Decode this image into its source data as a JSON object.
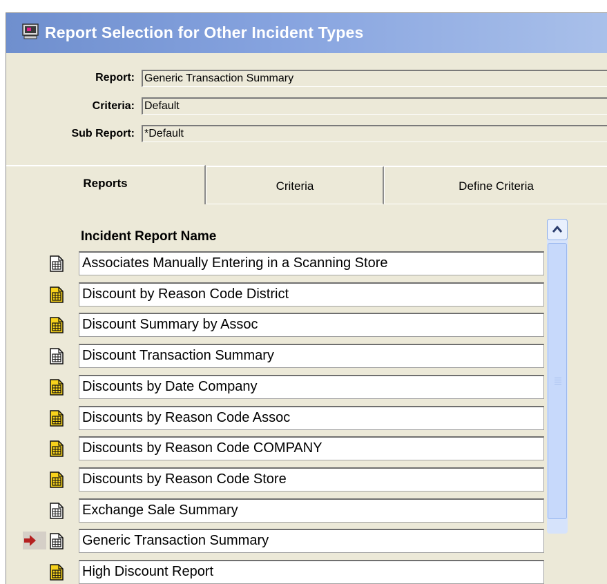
{
  "window": {
    "title": "Report Selection for Other Incident Types",
    "icon": "computer-monitor-icon"
  },
  "fields": [
    {
      "label": "Report:",
      "value": "Generic Transaction Summary"
    },
    {
      "label": "Criteria:",
      "value": "Default"
    },
    {
      "label": "Sub Report:",
      "value": "*Default"
    }
  ],
  "tabs": [
    {
      "label": "Reports",
      "active": true
    },
    {
      "label": "Criteria",
      "active": false
    },
    {
      "label": "Define Criteria",
      "active": false
    }
  ],
  "list": {
    "header": "Incident Report Name",
    "items": [
      {
        "name": "Associates Manually Entering in a Scanning Store",
        "icon": "report-gray-icon",
        "selected": false
      },
      {
        "name": "Discount by Reason Code District",
        "icon": "report-yellow-icon",
        "selected": false
      },
      {
        "name": "Discount Summary by Assoc",
        "icon": "report-yellow-icon",
        "selected": false
      },
      {
        "name": "Discount Transaction Summary",
        "icon": "report-gray-icon",
        "selected": false
      },
      {
        "name": "Discounts by Date Company",
        "icon": "report-yellow-icon",
        "selected": false
      },
      {
        "name": "Discounts by Reason Code Assoc",
        "icon": "report-yellow-icon",
        "selected": false
      },
      {
        "name": "Discounts by Reason Code COMPANY",
        "icon": "report-yellow-icon",
        "selected": false
      },
      {
        "name": "Discounts by Reason Code Store",
        "icon": "report-yellow-icon",
        "selected": false
      },
      {
        "name": "Exchange Sale Summary",
        "icon": "report-gray-icon",
        "selected": false
      },
      {
        "name": "Generic Transaction Summary",
        "icon": "report-gray-icon",
        "selected": true
      },
      {
        "name": "High Discount Report",
        "icon": "report-yellow-icon",
        "selected": false
      }
    ]
  },
  "colors": {
    "titlebar": "#7c99d8",
    "window_bg": "#ece9d8",
    "selection_arrow": "#b52020",
    "scrollbar": "#c7d9fb"
  }
}
